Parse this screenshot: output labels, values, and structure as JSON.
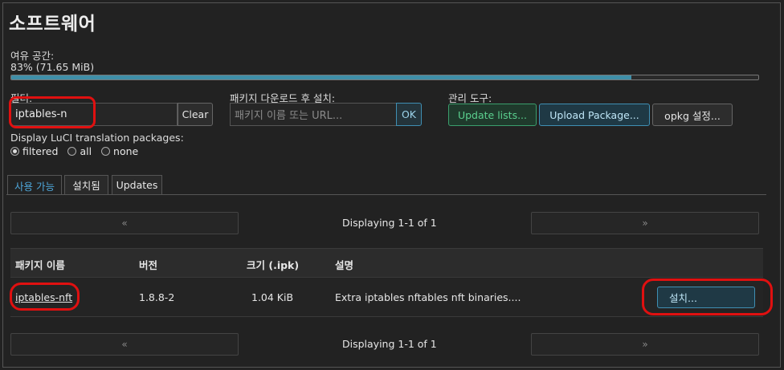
{
  "page": {
    "title": "소프트웨어"
  },
  "storage": {
    "label": "여유 공간:",
    "value": "83% (71.65 MiB)",
    "fill_fraction": 0.83
  },
  "filter": {
    "label": "필터:",
    "value": "iptables-n",
    "clear_label": "Clear"
  },
  "download": {
    "label": "패키지 다운로드 후 설치:",
    "placeholder": "패키지 이름 또는 URL...",
    "ok_label": "OK"
  },
  "tools": {
    "label": "관리 도구:",
    "update_lists": "Update lists...",
    "upload_package": "Upload Package...",
    "opkg_settings": "opkg 설정..."
  },
  "translation": {
    "label": "Display LuCI translation packages:",
    "options": [
      {
        "label": "filtered",
        "selected": true
      },
      {
        "label": "all",
        "selected": false
      },
      {
        "label": "none",
        "selected": false
      }
    ]
  },
  "tabs": [
    {
      "label": "사용 가능",
      "active": true
    },
    {
      "label": "설치됨",
      "active": false
    },
    {
      "label": "Updates",
      "active": false
    }
  ],
  "pager": {
    "prev": "«",
    "next": "»",
    "text": "Displaying 1-1 of 1"
  },
  "table": {
    "headers": [
      "패키지 이름",
      "버전",
      "크기 (.ipk)",
      "설명"
    ],
    "rows": [
      {
        "name": "iptables-nft",
        "version": "1.8.8-2",
        "size": "1.04 KiB",
        "description": "Extra iptables nftables nft binaries....",
        "action": "설치..."
      }
    ]
  },
  "colors": {
    "accent": "#3f8fa8",
    "highlight": "#e01010",
    "tab_active": "#4ea6d9"
  }
}
